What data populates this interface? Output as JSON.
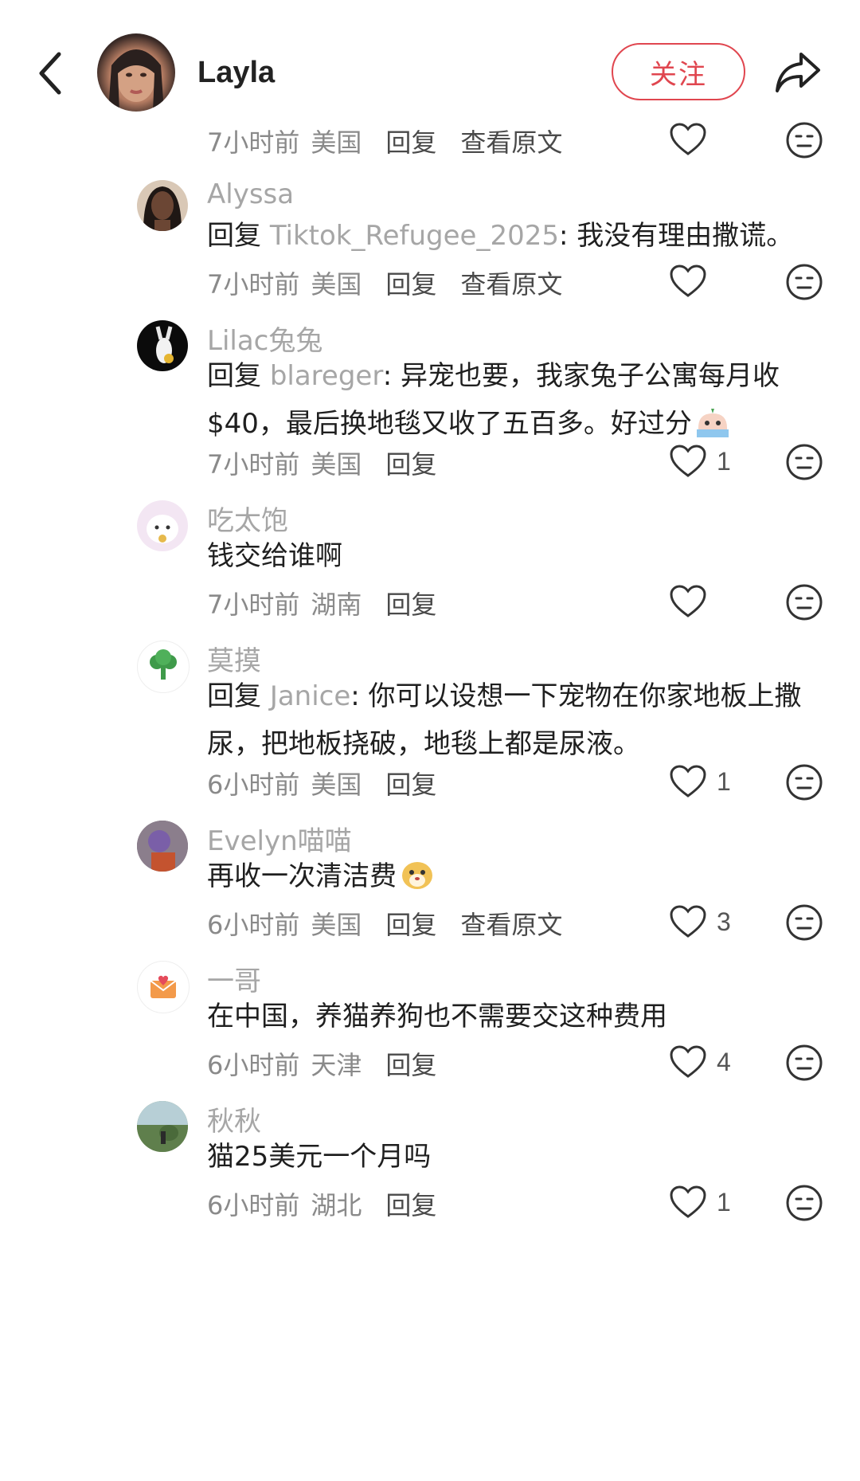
{
  "header": {
    "name": "Layla",
    "follow_label": "关注"
  },
  "top_meta": {
    "time": "7小时前",
    "location": "美国",
    "reply_label": "回复",
    "original_label": "查看原文"
  },
  "comments": [
    {
      "user": "Alyssa",
      "reply_prefix": "回复",
      "mention": "Tiktok_Refugee_2025",
      "text": ": 我没有理由撒谎。",
      "time": "7小时前",
      "location": "美国",
      "reply_label": "回复",
      "original_label": "查看原文",
      "likes": ""
    },
    {
      "user": "Lilac兔兔",
      "reply_prefix": "回复",
      "mention": "blareger",
      "text": ": 异宠也要，我家兔子公寓每月收$40，最后换地毯又收了五百多。好过分",
      "time": "7小时前",
      "location": "美国",
      "reply_label": "回复",
      "likes": "1",
      "emoji": "crying-face"
    },
    {
      "user": "吃太饱",
      "text": "钱交给谁啊",
      "time": "7小时前",
      "location": "湖南",
      "reply_label": "回复",
      "likes": ""
    },
    {
      "user": "莫摸",
      "reply_prefix": "回复",
      "mention": "Janice",
      "text": ": 你可以设想一下宠物在你家地板上撒尿，把地板挠破，地毯上都是尿液。",
      "time": "6小时前",
      "location": "美国",
      "reply_label": "回复",
      "likes": "1"
    },
    {
      "user": "Evelyn喵喵",
      "text": "再收一次清洁费",
      "time": "6小时前",
      "location": "美国",
      "reply_label": "回复",
      "original_label": "查看原文",
      "likes": "3",
      "emoji": "dog-face"
    },
    {
      "user": "一哥",
      "text": "在中国，养猫养狗也不需要交这种费用",
      "time": "6小时前",
      "location": "天津",
      "reply_label": "回复",
      "likes": "4"
    },
    {
      "user": "秋秋",
      "text": "猫25美元一个月吗",
      "time": "6小时前",
      "location": "湖北",
      "reply_label": "回复",
      "likes": "1"
    }
  ],
  "colors": {
    "accent": "#e0464f",
    "muted_text": "#a6a6a6",
    "body_text": "#1f1f1f"
  },
  "icons": [
    "back-chevron-icon",
    "share-arrow-icon",
    "heart-outline-icon",
    "neutral-face-icon"
  ]
}
